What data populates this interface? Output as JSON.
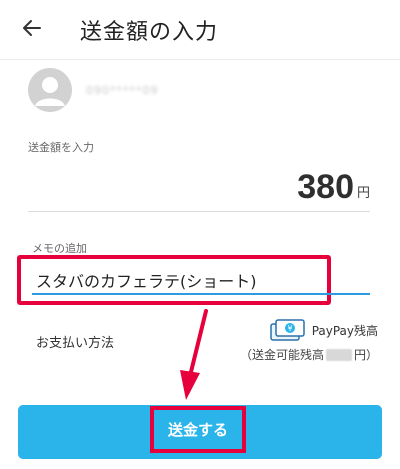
{
  "header": {
    "back_icon": "arrow-left-icon",
    "title": "送金額の入力"
  },
  "recipient": {
    "avatar_icon": "user-avatar-icon",
    "name": "090*****09"
  },
  "amount": {
    "label": "送金額を入力",
    "value": "380",
    "unit": "円"
  },
  "memo": {
    "label": "メモの追加",
    "value": "スタバのカフェラテ(ショート)"
  },
  "payment": {
    "label": "お支払い方法",
    "source_icon": "money-bills-icon",
    "source_name": "PayPay残高",
    "balance_prefix": "（送金可能残高",
    "balance_suffix": "円）"
  },
  "actions": {
    "send_label": "送金する"
  },
  "colors": {
    "accent": "#2ab4ea",
    "highlight": "#e6003c",
    "input_underline": "#2f9bdf"
  }
}
